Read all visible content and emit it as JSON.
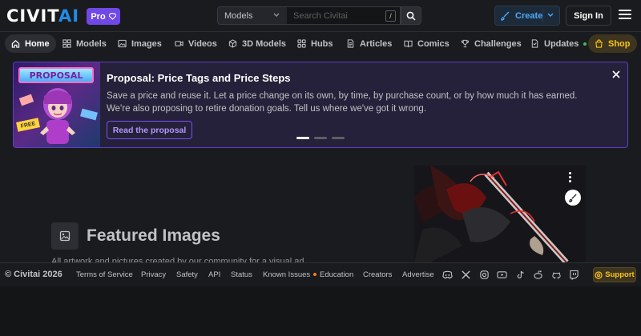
{
  "header": {
    "logo_main": "CIVIT",
    "logo_accent": "AI",
    "pro_label": "Pro",
    "search_scope": "Models",
    "search_placeholder": "Search Civitai",
    "search_hotkey": "/",
    "create_label": "Create",
    "signin_label": "Sign In"
  },
  "nav": {
    "items": [
      {
        "label": "Home",
        "icon": "home-icon"
      },
      {
        "label": "Models",
        "icon": "grid-icon"
      },
      {
        "label": "Images",
        "icon": "image-icon"
      },
      {
        "label": "Videos",
        "icon": "video-icon"
      },
      {
        "label": "3D Models",
        "icon": "cube-icon"
      },
      {
        "label": "Hubs",
        "icon": "hub-icon"
      },
      {
        "label": "Articles",
        "icon": "article-icon"
      },
      {
        "label": "Comics",
        "icon": "book-icon"
      },
      {
        "label": "Challenges",
        "icon": "trophy-icon"
      },
      {
        "label": "Updates",
        "icon": "updates-icon"
      },
      {
        "label": "Shop",
        "icon": "shop-icon"
      }
    ]
  },
  "banner": {
    "image_label": "PROPOSAL",
    "image_tag": "FREE",
    "title": "Proposal: Price Tags and Price Steps",
    "text": "Save a price and reuse it. Let a price change on its own, by time, by purchase count, or by how much it has earned. We're also proposing to retire donation goals. Tell us where we've got it wrong.",
    "button": "Read the proposal",
    "slides": 3,
    "active_slide": 0
  },
  "featured": {
    "title": "Featured Images",
    "subtitle": "All artwork and pictures created by our community for a visual ad..."
  },
  "footer": {
    "copyright": "© Civitai 2026",
    "links": [
      "Terms of Service",
      "Privacy",
      "Safety",
      "API",
      "Status",
      "Known Issues",
      "Education",
      "Creators",
      "Advertise"
    ],
    "social_icons": [
      "discord-icon",
      "x-icon",
      "instagram-icon",
      "youtube-icon",
      "tiktok-icon",
      "reddit-icon",
      "github-icon",
      "twitch-icon"
    ],
    "support_label": "Support"
  },
  "colors": {
    "accent": "#7048e8",
    "blue": "#228be6",
    "shop": "#fcc419",
    "background": "#1a1b1e"
  }
}
